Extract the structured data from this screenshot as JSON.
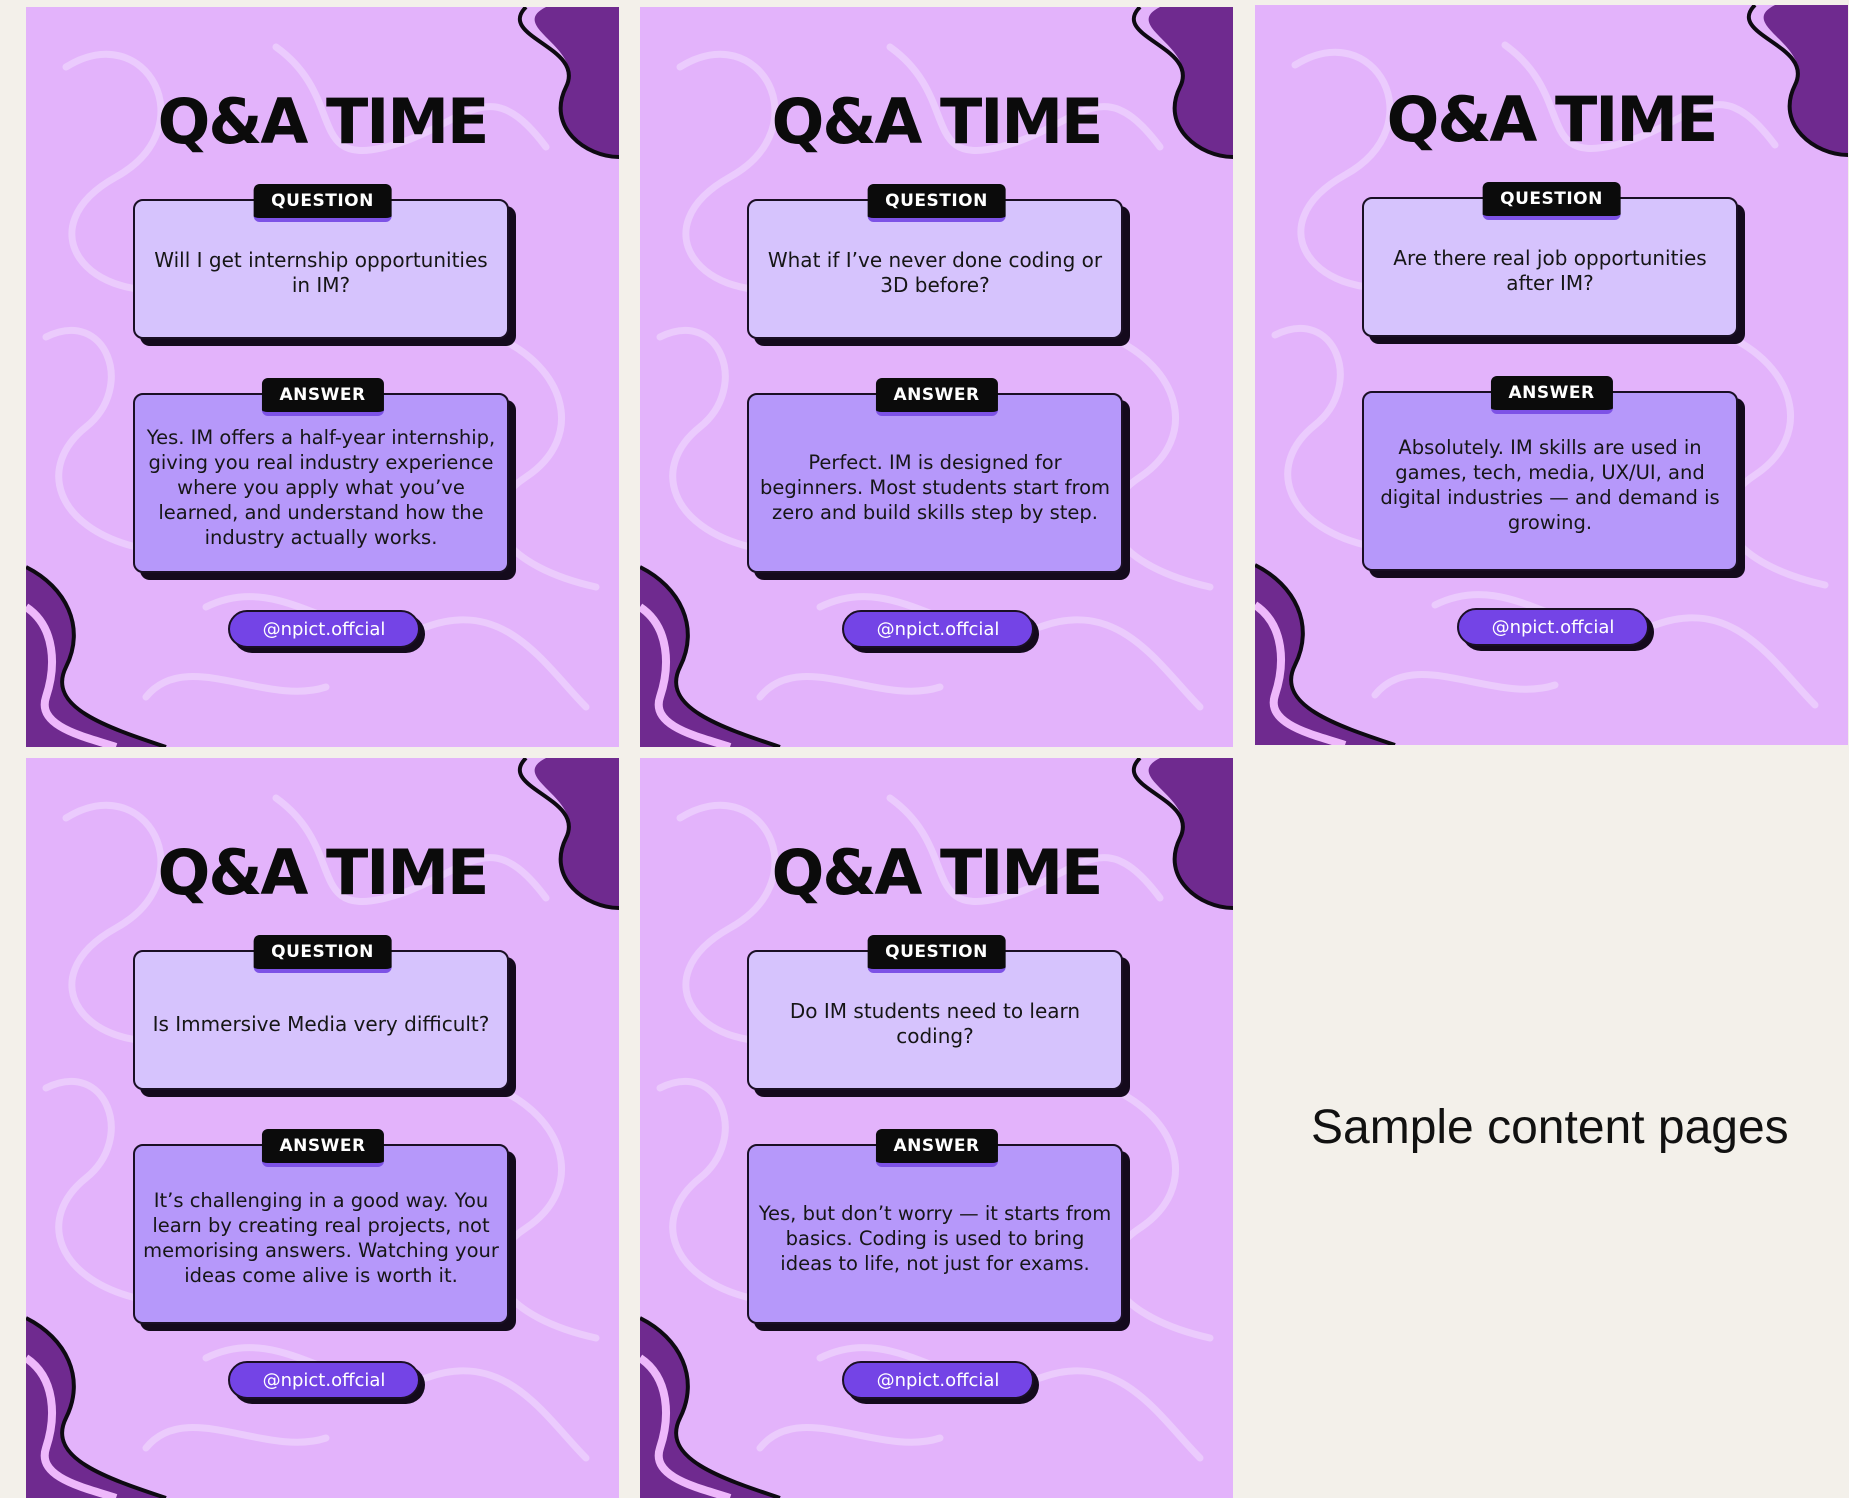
{
  "cards": [
    {
      "title": "Q&A TIME",
      "question_tag": "QUESTION",
      "question": "Will I get internship opportunities in IM?",
      "answer_tag": "ANSWER",
      "answer": "Yes. IM offers a half-year internship, giving you real industry experience where you apply what you’ve learned, and understand how the industry actually works.",
      "handle": "@npict.offcial"
    },
    {
      "title": "Q&A TIME",
      "question_tag": "QUESTION",
      "question": "What if I’ve never done coding or 3D before?",
      "answer_tag": "ANSWER",
      "answer": "Perfect. IM is designed for beginners. Most students start from zero and build skills step by step.",
      "handle": "@npict.offcial"
    },
    {
      "title": "Q&A TIME",
      "question_tag": "QUESTION",
      "question": "Are there real job opportunities after IM?",
      "answer_tag": "ANSWER",
      "answer": "Absolutely. IM skills are used in games, tech, media, UX/UI, and digital industries — and demand is growing.",
      "handle": "@npict.offcial"
    },
    {
      "title": "Q&A TIME",
      "question_tag": "QUESTION",
      "question": "Is Immersive Media very difficult?",
      "answer_tag": "ANSWER",
      "answer": "It’s challenging in a good way. You learn by creating real projects, not memorising answers. Watching your ideas come alive is worth it.",
      "handle": "@npict.offcial"
    },
    {
      "title": "Q&A TIME",
      "question_tag": "QUESTION",
      "question": "Do IM students need to learn coding?",
      "answer_tag": "ANSWER",
      "answer": "Yes, but don’t worry — it starts from basics. Coding is used to bring ideas to life, not just for exams.",
      "handle": "@npict.offcial"
    }
  ],
  "caption": "Sample content pages",
  "colors": {
    "card_background": "#e3b3fb",
    "question_box": "#d6c3fd",
    "answer_box": "#b698fa",
    "handle_pill": "#7444e6",
    "corner_blob": "#6f2a8f",
    "page_background": "#f3f0ea"
  }
}
